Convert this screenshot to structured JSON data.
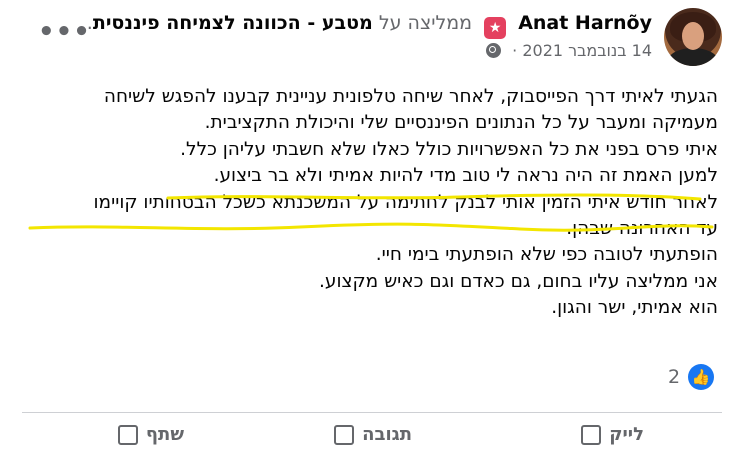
{
  "header": {
    "author": "Anat Harnõy",
    "recommends_text": "ממליצה על",
    "page_name": "מטבע - הכוונה לצמיחה פיננסית",
    "date": "14 בנובמבר 2021",
    "more_label": "•••"
  },
  "body": {
    "lines": [
      "הגעתי לאיתי דרך הפייסבוק, לאחר שיחה טלפונית עניינית קבענו להפגש לשיחה",
      "מעמיקה ומעבר על כל הנתונים הפיננסיים שלי והיכולת התקציבית.",
      "איתי פרס בפני את כל האפשרויות כולל כאלו שלא חשבתי עליהן כלל.",
      "למען האמת זה היה נראה לי טוב מדי להיות אמיתי ולא בר ביצוע.",
      "לאחר חודש איתי הזמין אותי לבנק לחתימה על המשכנתא כשכל הבטחותיו קויימו",
      "עד האחרונה שבהן.",
      "הופתעתי לטובה כפי שלא הופתעתי בימי חיי.",
      "אני ממליצה עליו בחום, גם כאדם וגם כאיש מקצוע.",
      "הוא אמיתי, ישר והגון."
    ],
    "highlight_color": "#f3e600"
  },
  "reactions": {
    "count": "2",
    "like_icon": "thumbs-up-icon",
    "color": "#1877f2"
  },
  "actions": {
    "like": "לייק",
    "comment": "תגובה",
    "share": "שתף"
  }
}
